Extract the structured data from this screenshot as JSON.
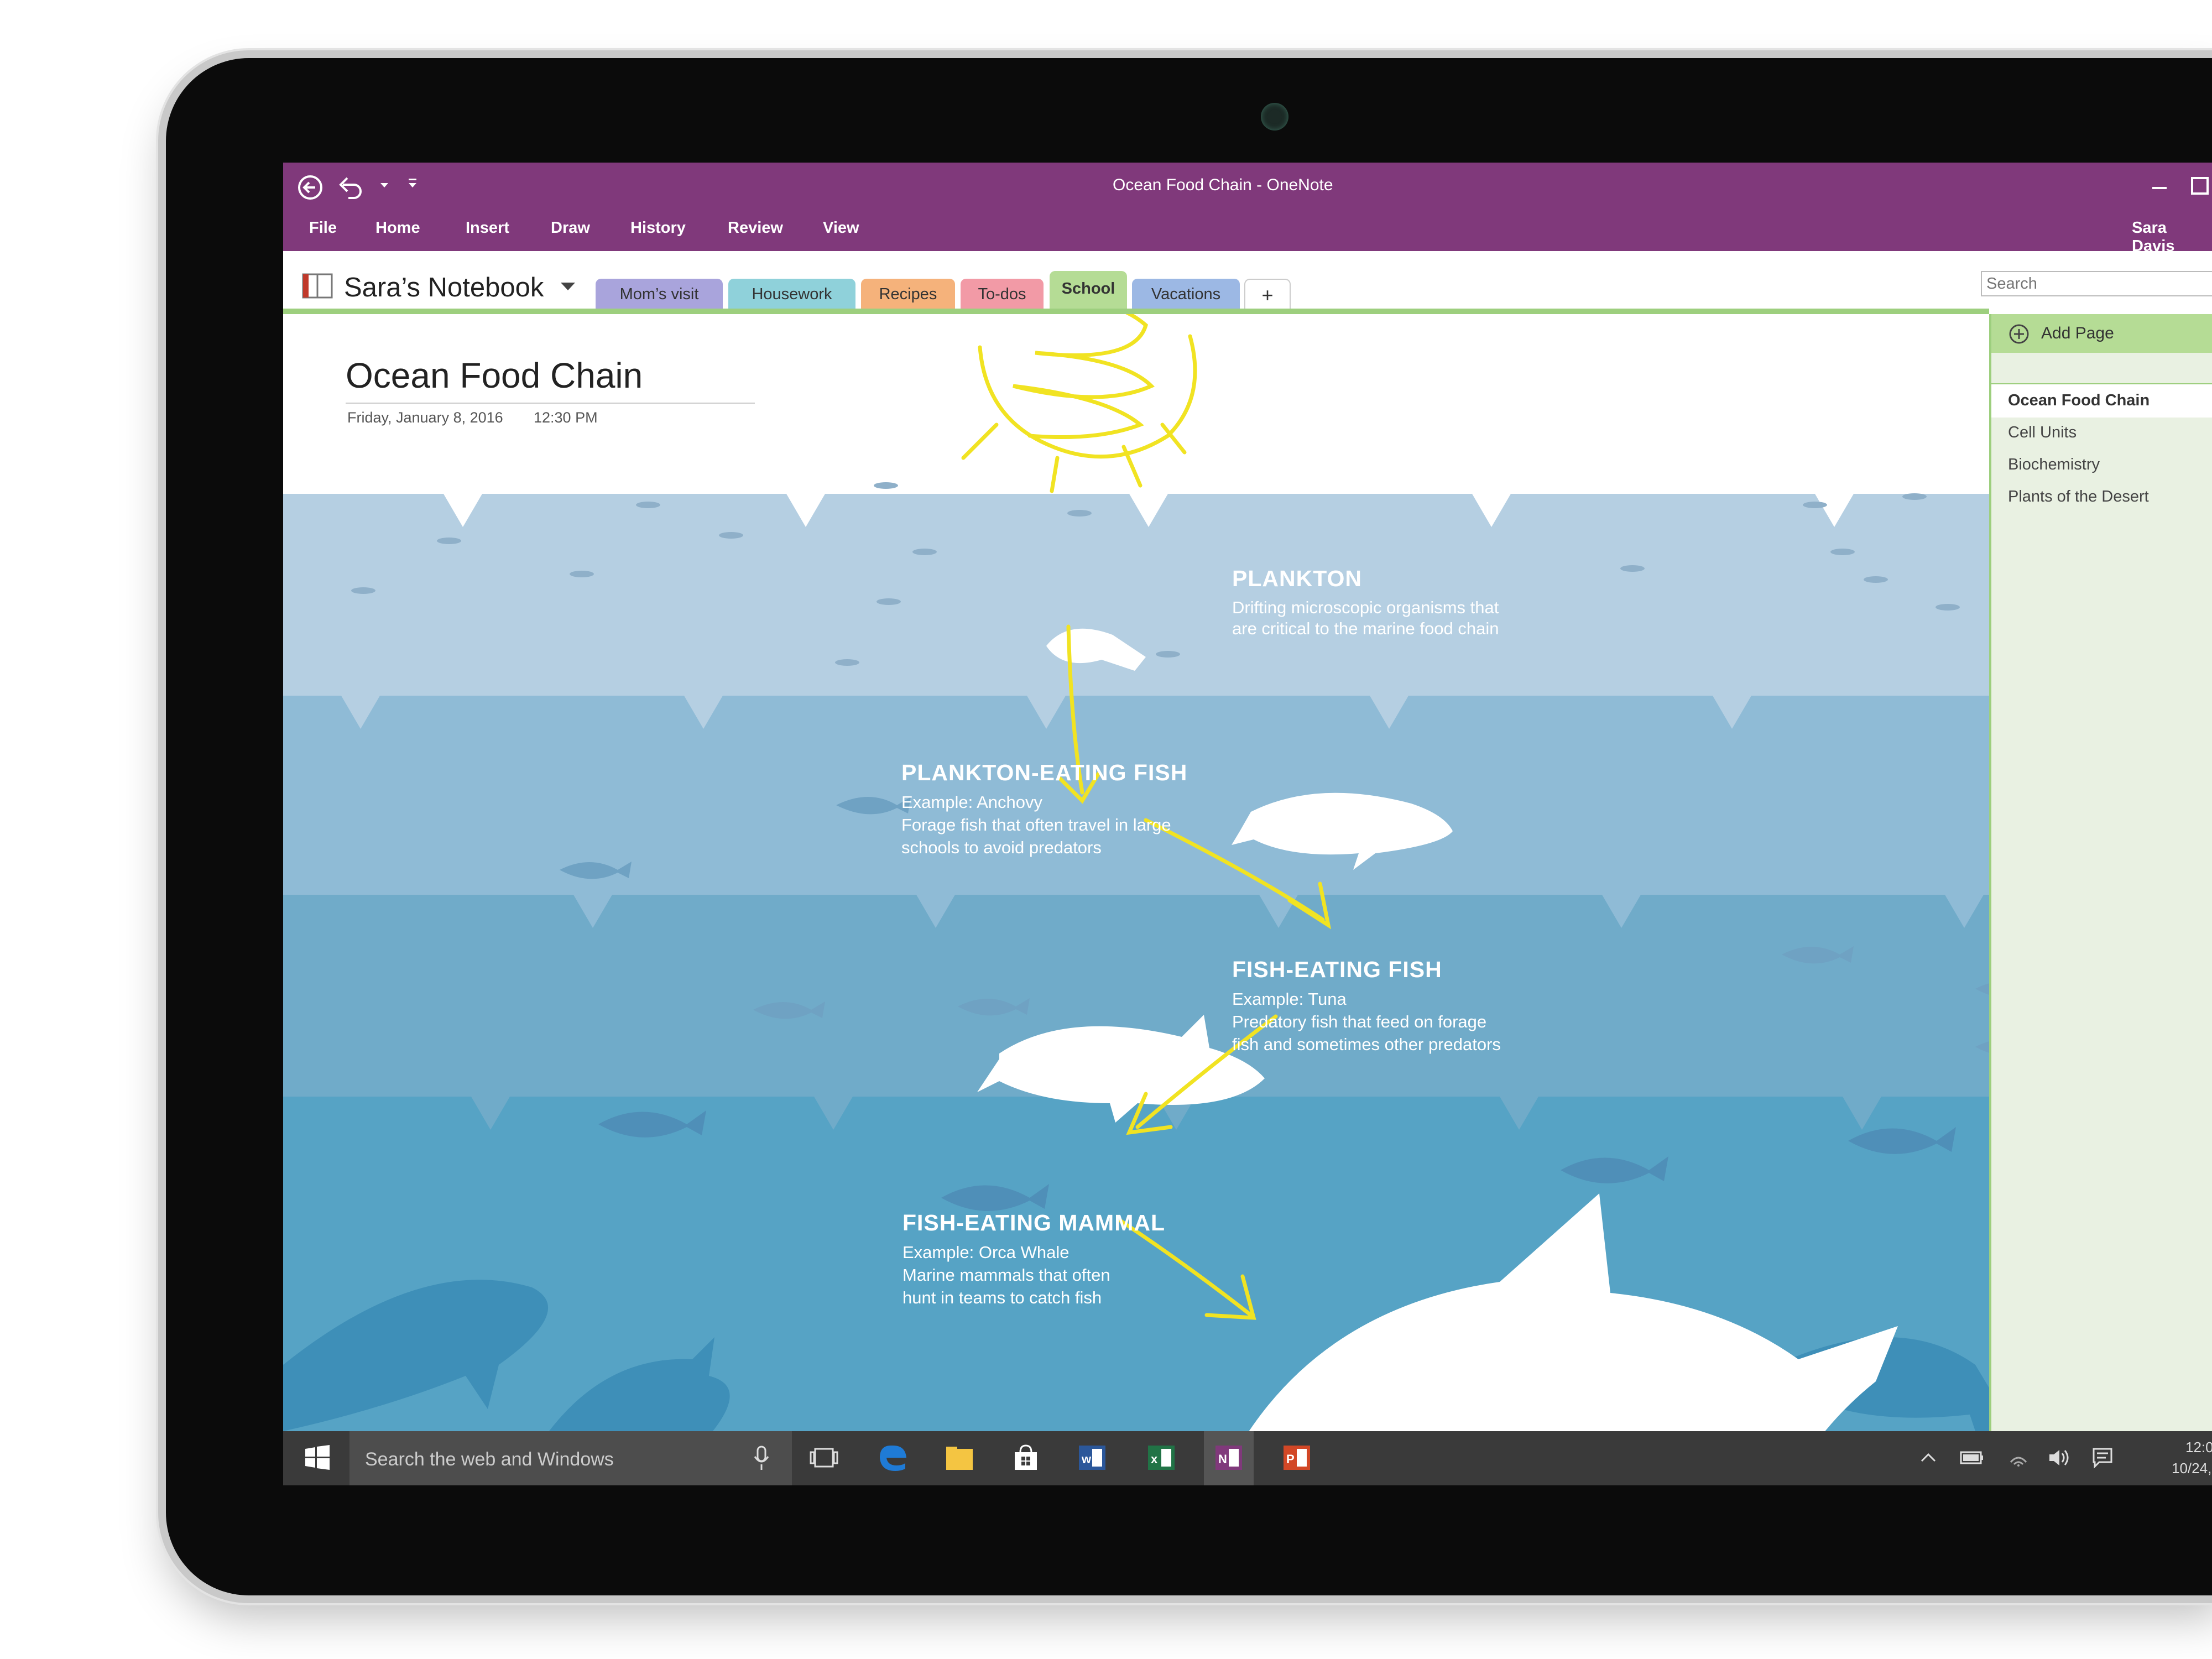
{
  "window": {
    "title": "Ocean Food Chain - OneNote",
    "user": "Sara Davis"
  },
  "menu": [
    "File",
    "Home",
    "Insert",
    "Draw",
    "History",
    "Review",
    "View"
  ],
  "notebook": {
    "name": "Sara’s Notebook"
  },
  "sections": [
    {
      "label": "Mom’s visit",
      "color": "#a9a4dc"
    },
    {
      "label": "Housework",
      "color": "#8fd1da"
    },
    {
      "label": "Recipes",
      "color": "#f5b27b"
    },
    {
      "label": "To-dos",
      "color": "#f29aa6"
    },
    {
      "label": "School",
      "color": "#b5dc95"
    },
    {
      "label": "Vacations",
      "color": "#9cb8e4"
    }
  ],
  "add_section": "+",
  "search": {
    "placeholder": "Search"
  },
  "page": {
    "title": "Ocean Food Chain",
    "date": "Friday, January 8, 2016",
    "time": "12:30 PM"
  },
  "levels": [
    {
      "heading": "PLANKTON",
      "lines": [
        "Drifting microscopic organisms that",
        "are critical to the marine food chain"
      ]
    },
    {
      "heading": "PLANKTON-EATING FISH",
      "lines": [
        "Example: Anchovy",
        "Forage fish that often travel in large",
        "schools to avoid predators"
      ]
    },
    {
      "heading": "FISH-EATING FISH",
      "lines": [
        "Example: Tuna",
        "Predatory fish that feed on forage",
        "fish and sometimes other predators"
      ]
    },
    {
      "heading": "FISH-EATING MAMMAL",
      "lines": [
        "Example: Orca Whale",
        "Marine mammals that often",
        "hunt in teams to catch fish"
      ]
    }
  ],
  "pages_panel": {
    "add_label": "Add Page",
    "items": [
      "Ocean Food Chain",
      "Cell Units",
      "Biochemistry",
      "Plants of the Desert"
    ]
  },
  "taskbar": {
    "search_placeholder": "Search the web and Windows",
    "clock_time": "12:0",
    "clock_date": "10/24,"
  },
  "colors": {
    "accent": "#80397b",
    "band1": "#b5cfe2",
    "band2": "#8fbbd6",
    "band3": "#70abc9",
    "band4": "#56a3c5",
    "ink": "#f1e322"
  }
}
